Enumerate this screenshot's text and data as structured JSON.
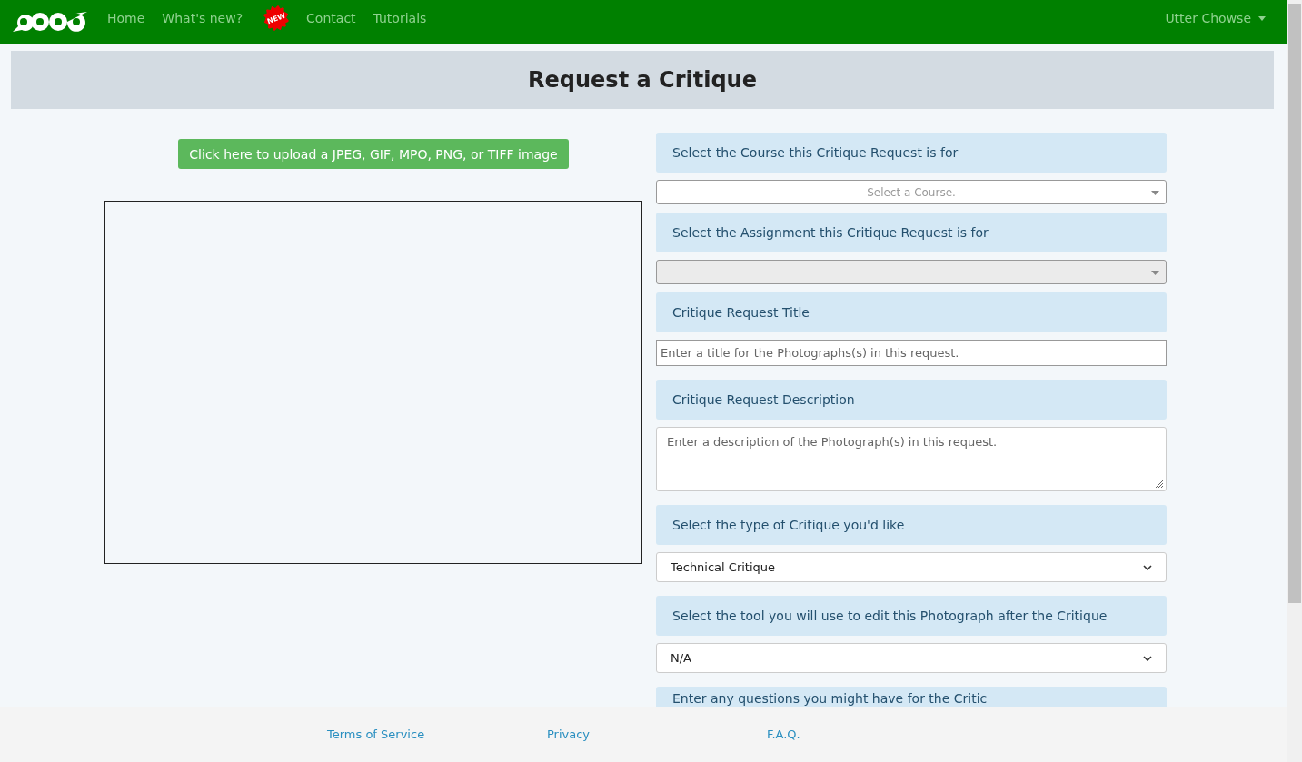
{
  "navbar": {
    "links": [
      {
        "label": "Home"
      },
      {
        "label": "What's new?",
        "badge": "NEW"
      },
      {
        "label": "Contact"
      },
      {
        "label": "Tutorials"
      }
    ],
    "user": "Utter Chowse"
  },
  "page_title": "Request a Critique",
  "upload_button": "Click here to upload a JPEG, GIF, MPO, PNG, or TIFF image",
  "form": [
    {
      "label": "Select the Course this Critique Request is for",
      "kind": "combo",
      "placeholder": "Select a Course.",
      "disabled": false
    },
    {
      "label": "Select the Assignment this Critique Request is for",
      "kind": "combo",
      "disabled": true
    },
    {
      "label": "Critique Request Title",
      "kind": "text",
      "placeholder": "Enter a title for the Photographs(s) in this request."
    },
    {
      "label": "Critique Request Description",
      "kind": "textarea",
      "placeholder": "Enter a description of the Photograph(s) in this request."
    },
    {
      "label": "Select the type of Critique you'd like",
      "kind": "select",
      "value": "Technical Critique"
    },
    {
      "label": "Select the tool you will use to edit this Photograph after the Critique",
      "kind": "select",
      "value": "N/A"
    },
    {
      "label": "Enter any questions you might have for the Critic",
      "kind": "none"
    }
  ],
  "footer_links": [
    "Terms of Service",
    "Privacy",
    "F.A.Q."
  ]
}
